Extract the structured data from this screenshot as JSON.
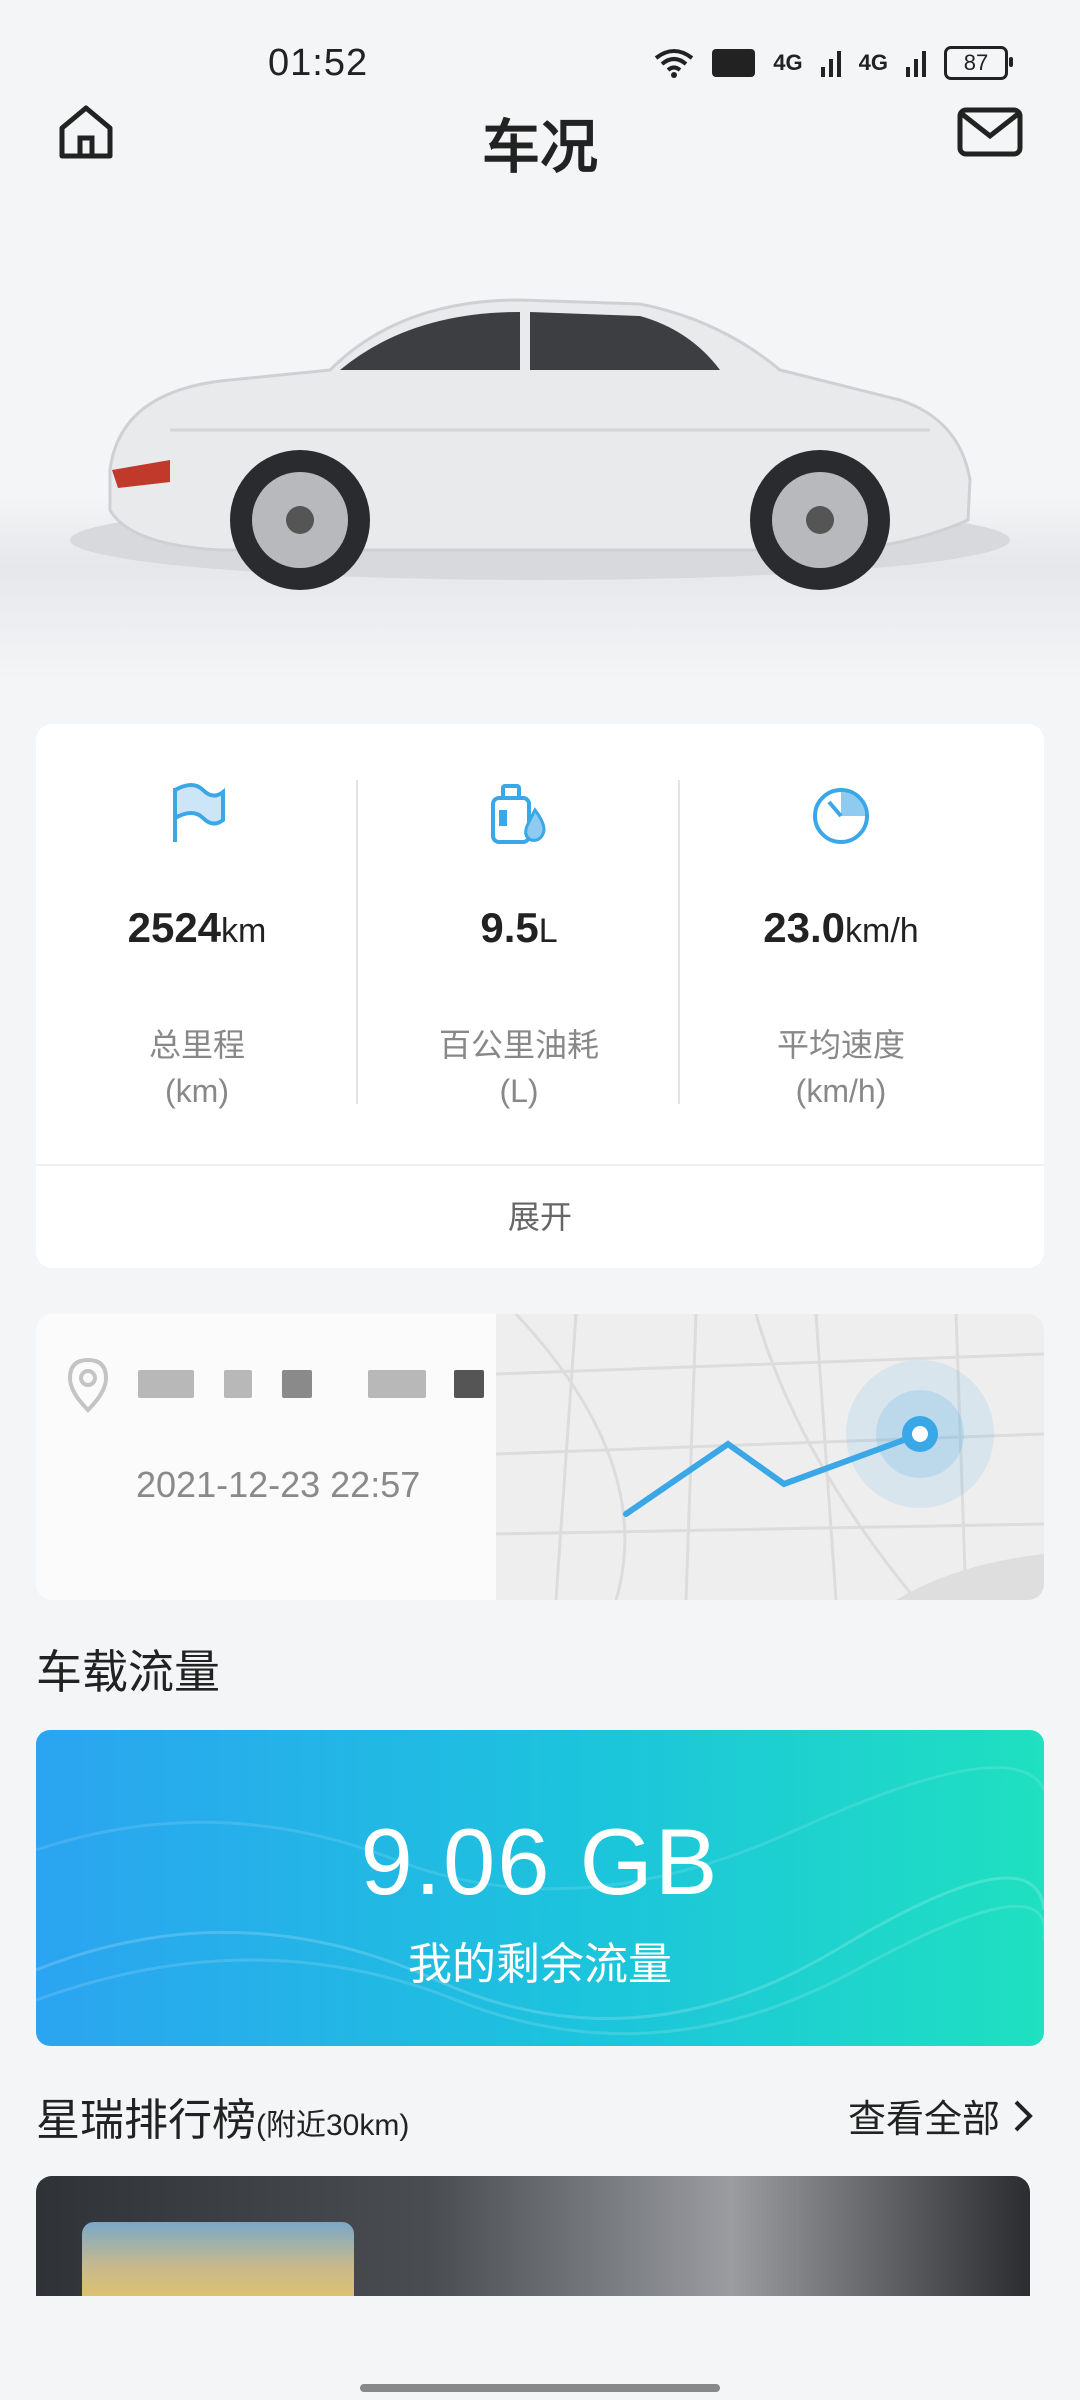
{
  "status": {
    "time": "01:52",
    "network1": "4G",
    "network2": "4G",
    "hd": "HD",
    "battery": "87"
  },
  "header": {
    "title": "车况"
  },
  "stats": [
    {
      "value": "2524",
      "unit": "km",
      "label": "总里程",
      "sublabel": "(km)"
    },
    {
      "value": "9.5",
      "unit": "L",
      "label": "百公里油耗",
      "sublabel": "(L)"
    },
    {
      "value": "23.0",
      "unit": "km/h",
      "label": "平均速度",
      "sublabel": "(km/h)"
    }
  ],
  "stats_expand": "展开",
  "location": {
    "time": "2021-12-23 22:57"
  },
  "data_section": {
    "title": "车载流量",
    "value": "9.06 GB",
    "sub": "我的剩余流量"
  },
  "ranking": {
    "title": "星瑞排行榜",
    "subtitle": "(附近30km)",
    "view_all": "查看全部"
  },
  "colors": {
    "accent": "#3aa7e6",
    "data_card_start": "#2ba4f1",
    "data_card_end": "#1fe0c0"
  }
}
